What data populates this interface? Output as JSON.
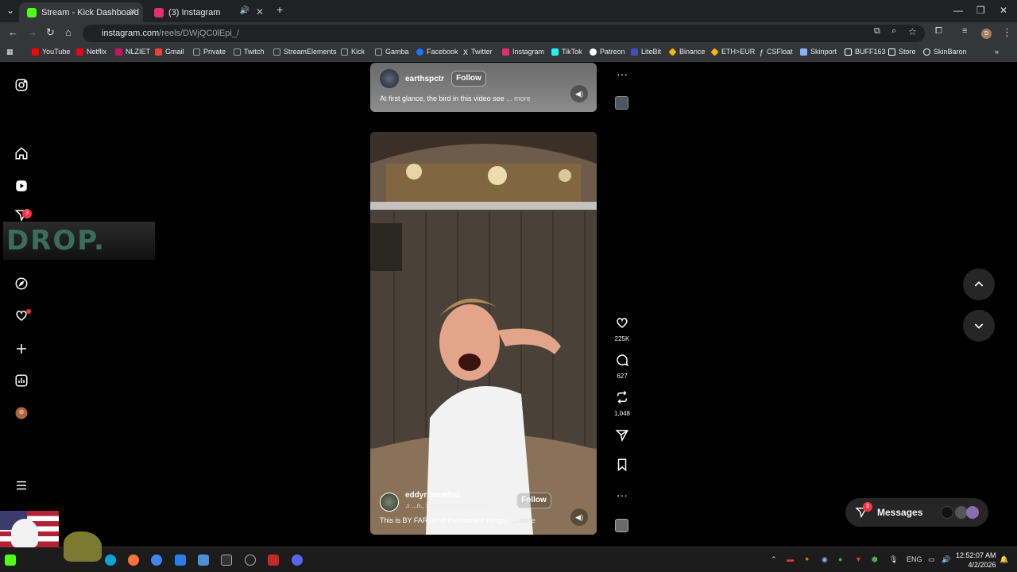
{
  "browser": {
    "tabs": [
      {
        "label": "Stream - Kick Dashboard",
        "color": "#53fc18"
      },
      {
        "label": "(3) Instagram",
        "color": "#e1306c"
      }
    ],
    "url_host": "instagram.com",
    "url_path": "/reels/DWjQC0lEpi_/",
    "bookmarks": [
      {
        "label": "YouTube",
        "icon": "youtube-icon",
        "color": "#ff0000"
      },
      {
        "label": "Netflix",
        "icon": "netflix-icon",
        "color": "#e50914"
      },
      {
        "label": "NLZIET",
        "icon": "nlziet-icon",
        "color": "#c2185b"
      },
      {
        "label": "Gmail",
        "icon": "gmail-icon",
        "color": "#ea4335"
      },
      {
        "label": "Private",
        "icon": "folder-icon",
        "color": "#9aa0a6"
      },
      {
        "label": "Twitch",
        "icon": "folder-icon",
        "color": "#9aa0a6"
      },
      {
        "label": "StreamElements",
        "icon": "folder-icon",
        "color": "#9aa0a6"
      },
      {
        "label": "Kick",
        "icon": "folder-icon",
        "color": "#9aa0a6"
      },
      {
        "label": "Gamba",
        "icon": "folder-icon",
        "color": "#9aa0a6"
      },
      {
        "label": "Facebook",
        "icon": "facebook-icon",
        "color": "#1877f2"
      },
      {
        "label": "Twitter",
        "icon": "x-icon",
        "color": "#ffffff"
      },
      {
        "label": "Instagram",
        "icon": "instagram-icon",
        "color": "#e1306c"
      },
      {
        "label": "TikTok",
        "icon": "tiktok-icon",
        "color": "#25f4ee"
      },
      {
        "label": "Patreon",
        "icon": "patreon-icon",
        "color": "#ffffff"
      },
      {
        "label": "LiteBit",
        "icon": "litebit-icon",
        "color": "#3f51b5"
      },
      {
        "label": "Binance",
        "icon": "binance-icon",
        "color": "#f0b90b"
      },
      {
        "label": "ETH>EUR",
        "icon": "binance-icon",
        "color": "#f0b90b"
      },
      {
        "label": "CSFloat",
        "icon": "csfloat-icon",
        "color": "#ffffff"
      },
      {
        "label": "Skinport",
        "icon": "skinport-icon",
        "color": "#8ab4f8"
      },
      {
        "label": "BUFF163",
        "icon": "buff-icon",
        "color": "#ffffff"
      },
      {
        "label": "Store",
        "icon": "store-icon",
        "color": "#ffffff"
      },
      {
        "label": "SkinBaron",
        "icon": "skinbaron-icon",
        "color": "#ffffff"
      }
    ]
  },
  "sidebar": {
    "notifications_badge": "3",
    "overlay_text": "DROP."
  },
  "reels": {
    "top": {
      "username": "earthspctr",
      "follow_label": "Follow",
      "caption": "At first glance, the bird in this video see",
      "more_label": "... more"
    },
    "main": {
      "username": "eddyrosenthal",
      "follow_label": "Follow",
      "audio": "...n., Skepta, PlaqueBoyMax, D",
      "caption": "This is BY FAR on of the craziest things I",
      "more_label": "... more"
    }
  },
  "actions": {
    "likes": "225K",
    "comments": "627",
    "reposts": "1,048"
  },
  "messages": {
    "label": "Messages",
    "badge": "3"
  },
  "taskbar": {
    "language": "ENG",
    "time": "12:52:07 AM",
    "date": "4/2/2026"
  }
}
